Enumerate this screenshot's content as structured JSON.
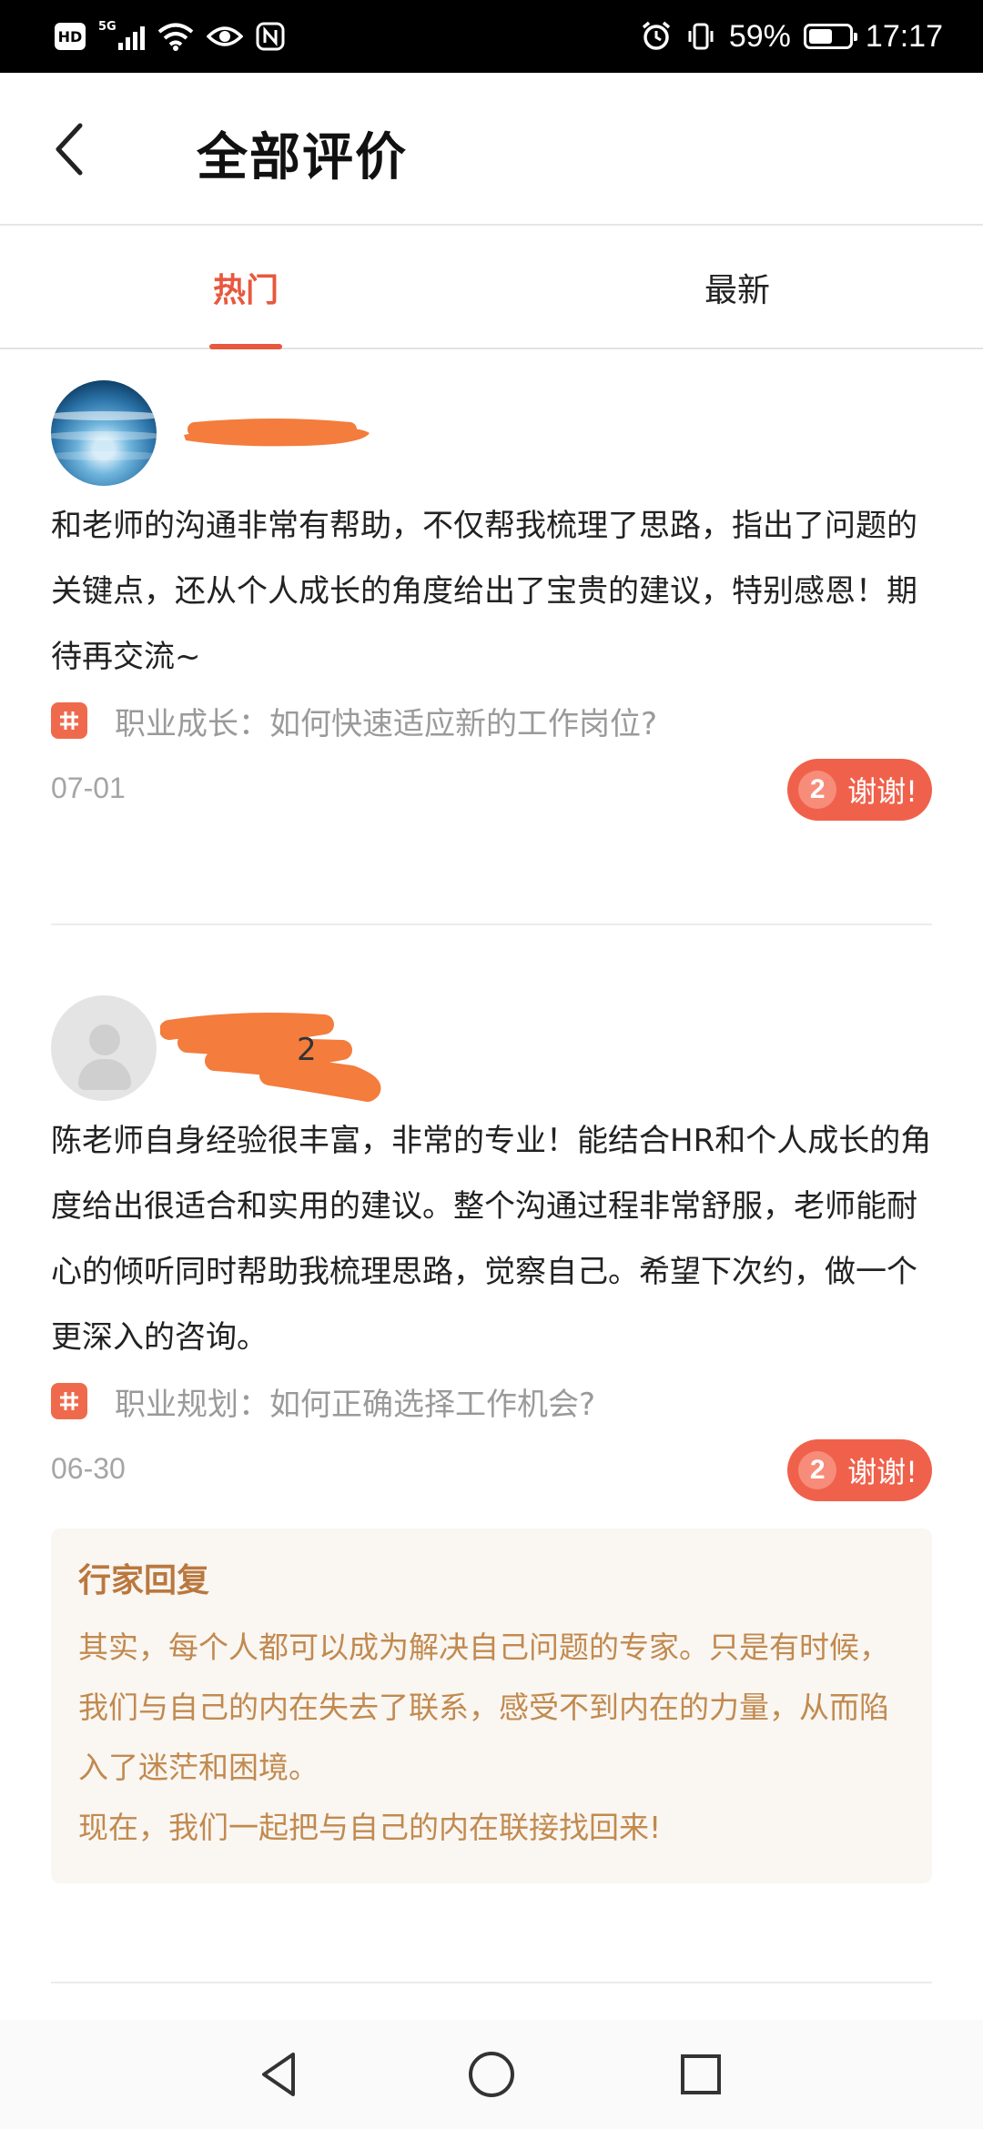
{
  "status_bar": {
    "hd": "HD",
    "network": "5G",
    "battery_percent_text": "59%",
    "battery_level": 0.59,
    "time": "17:17"
  },
  "header": {
    "title": "全部评价",
    "back_icon": "chevron-left-icon"
  },
  "tabs": [
    {
      "label": "热门",
      "active": true
    },
    {
      "label": "最新",
      "active": false
    }
  ],
  "colors": {
    "accent": "#e8583d",
    "thanks_bg": "#f0614b",
    "reply_title": "#b9783f",
    "reply_text": "#c18a4f",
    "reply_bg": "#faf6f2",
    "redaction": "#f47c3c"
  },
  "reviews": [
    {
      "user_name_visible": "",
      "avatar": "ocean-photo",
      "text": "和老师的沟通非常有帮助，不仅帮我梳理了思路，指出了问题的关键点，还从个人成长的角度给出了宝贵的建议，特别感恩！期待再交流~",
      "topic": "职业成长：如何快速适应新的工作岗位?",
      "date": "07-01",
      "thanks_count": "2",
      "thanks_label": "谢谢!"
    },
    {
      "user_name_visible": "2",
      "avatar": "default-person",
      "text": "陈老师自身经验很丰富，非常的专业！能结合HR和个人成长的角度给出很适合和实用的建议。整个沟通过程非常舒服，老师能耐心的倾听同时帮助我梳理思路，觉察自己。希望下次约，做一个更深入的咨询。",
      "topic": "职业规划：如何正确选择工作机会?",
      "date": "06-30",
      "thanks_count": "2",
      "thanks_label": "谢谢!",
      "reply": {
        "title": "行家回复",
        "lines": [
          "其实，每个人都可以成为解决自己问题的专家。只是有时候，我们与自己的内在失去了联系，感受不到内在的力量，从而陷入了迷茫和困境。",
          "现在，我们一起把与自己的内在联接找回来!"
        ]
      }
    }
  ],
  "nav_bar": {
    "back": "triangle-back-icon",
    "home": "circle-home-icon",
    "recents": "square-recents-icon"
  }
}
